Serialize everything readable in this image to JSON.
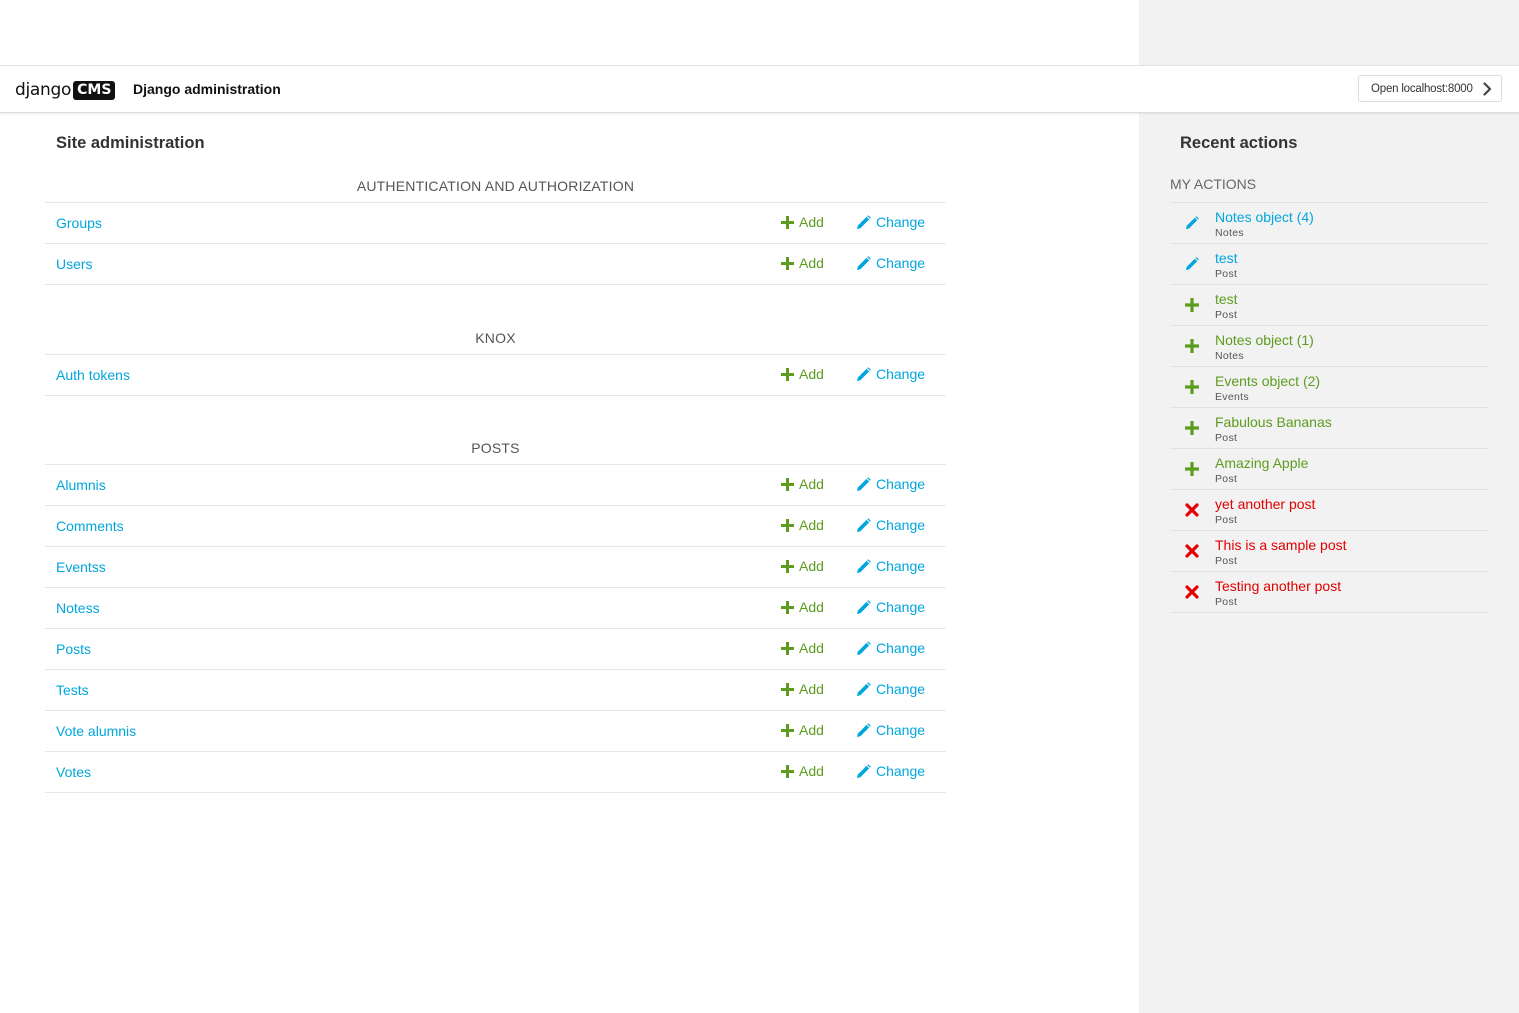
{
  "header": {
    "logo_word": "django",
    "logo_badge": "CMS",
    "title": "Django administration",
    "open_button": "Open localhost:8000"
  },
  "main": {
    "heading": "Site administration",
    "add_label": "Add",
    "change_label": "Change",
    "modules": [
      {
        "caption": "AUTHENTICATION AND AUTHORIZATION",
        "models": [
          "Groups",
          "Users"
        ]
      },
      {
        "caption": "KNOX",
        "models": [
          "Auth tokens"
        ]
      },
      {
        "caption": "POSTS",
        "models": [
          "Alumnis",
          "Comments",
          "Eventss",
          "Notess",
          "Posts",
          "Tests",
          "Vote alumnis",
          "Votes"
        ]
      }
    ]
  },
  "sidebar": {
    "heading": "Recent actions",
    "my_actions_caption": "MY ACTIONS",
    "actions": [
      {
        "kind": "change",
        "title": "Notes object (4)",
        "type": "Notes"
      },
      {
        "kind": "change",
        "title": "test",
        "type": "Post"
      },
      {
        "kind": "add",
        "title": "test",
        "type": "Post"
      },
      {
        "kind": "add",
        "title": "Notes object (1)",
        "type": "Notes"
      },
      {
        "kind": "add",
        "title": "Events object (2)",
        "type": "Events"
      },
      {
        "kind": "add",
        "title": "Fabulous Bananas",
        "type": "Post"
      },
      {
        "kind": "add",
        "title": "Amazing Apple",
        "type": "Post"
      },
      {
        "kind": "delete",
        "title": "yet another post",
        "type": "Post"
      },
      {
        "kind": "delete",
        "title": "This is a sample post",
        "type": "Post"
      },
      {
        "kind": "delete",
        "title": "Testing another post",
        "type": "Post"
      }
    ]
  },
  "colors": {
    "link": "#00a6dc",
    "add": "#5d9c1f",
    "delete": "#e30000",
    "sidebar_bg": "#f2f2f2"
  },
  "icons": {
    "add": "plus-icon",
    "change": "pencil-icon",
    "delete": "x-icon",
    "open": "chevron-right-icon"
  }
}
